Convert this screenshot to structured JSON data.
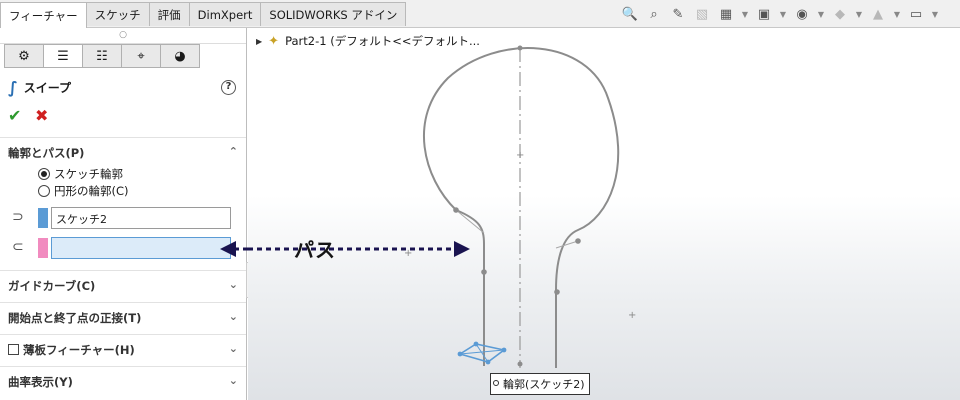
{
  "tabs": [
    {
      "label": "フィーチャー"
    },
    {
      "label": "スケッチ"
    },
    {
      "label": "評価"
    },
    {
      "label": "DimXpert"
    },
    {
      "label": "SOLIDWORKS アドイン"
    }
  ],
  "toolbar_icons": [
    "zoom-to-fit-icon",
    "zoom-to-area-icon",
    "previous-view-icon",
    "section-view-icon",
    "view-orientation-icon",
    "display-style-icon",
    "hide-show-icon",
    "edit-appearance-icon",
    "apply-scene-icon",
    "view-settings-icon"
  ],
  "panel": {
    "feature_name": "スイープ",
    "sections": {
      "profile_path": {
        "title": "輪郭とパス(P)",
        "radio_sketch": "スケッチ輪郭",
        "radio_circle": "円形の輪郭(C)",
        "profile_value": "スケッチ2",
        "path_value": ""
      },
      "guide_curves": "ガイドカーブ(C)",
      "tangency": "開始点と終了点の正接(T)",
      "thin_feature": "薄板フィーチャー(H)",
      "curvature": "曲率表示(Y)"
    }
  },
  "colors": {
    "profile_swatch": "#5b9bd5",
    "path_swatch": "#f18bbf",
    "arrow": "#1a1450",
    "sketch_line": "#8c8c8c"
  },
  "viewport": {
    "tree_item": "Part2-1 (デフォルト<<デフォルト...",
    "callout": "パス",
    "tooltip": "輪郭(スケッチ2)"
  }
}
